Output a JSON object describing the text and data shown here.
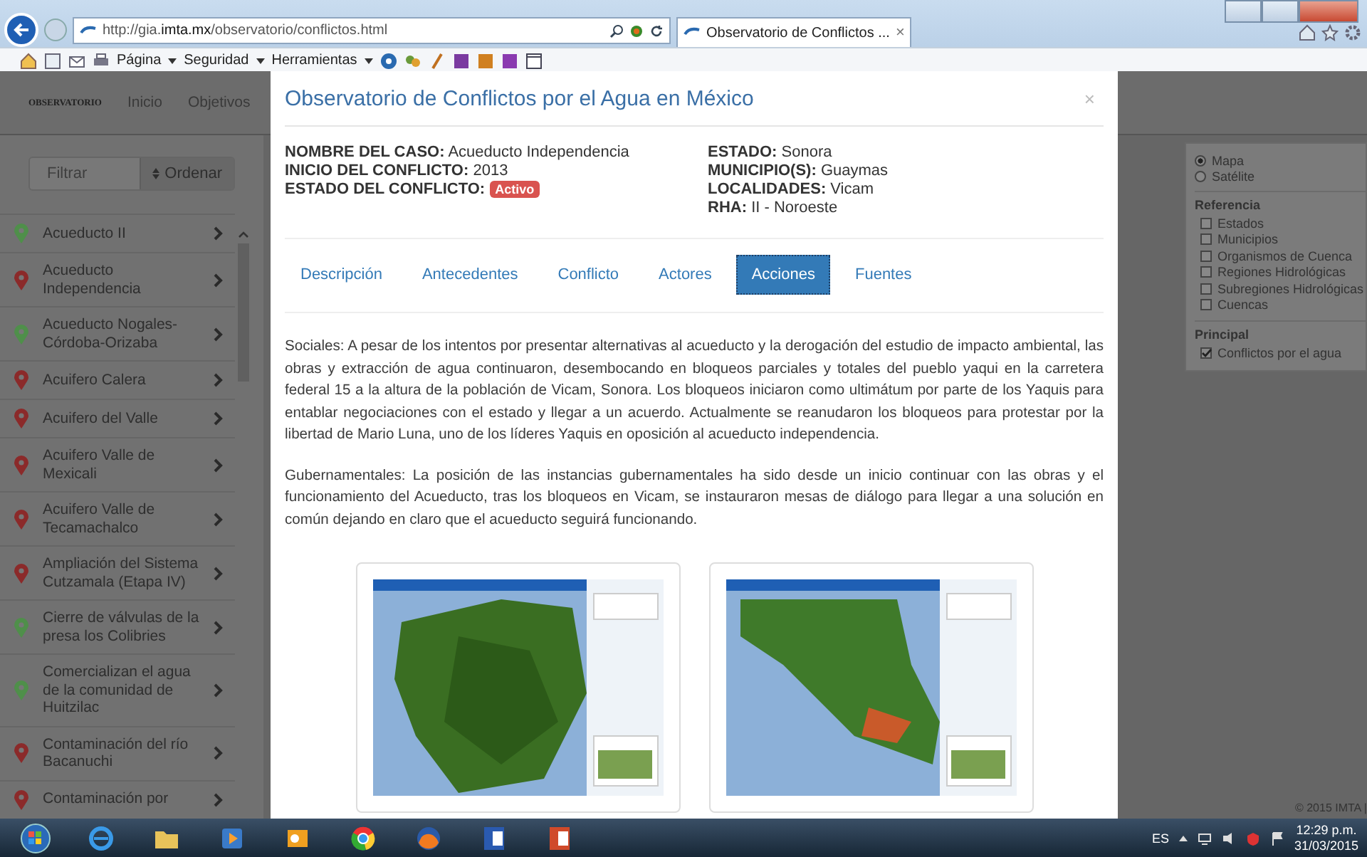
{
  "browser": {
    "address": "http://gia.**imta.mx**/observatorio/conflictos.html",
    "tab": {
      "title": "Observatorio de Conflictos ...",
      "close": "×"
    },
    "menus": [
      {
        "label": "Página"
      },
      {
        "label": "Seguridad"
      },
      {
        "label": "Herramientas"
      }
    ]
  },
  "site_nav": {
    "logo": "OBSERVATORIO",
    "links": [
      "Inicio",
      "Objetivos"
    ]
  },
  "sidebar": {
    "filter": {
      "placeholder": "Filtrar"
    },
    "sort_button": "Ordenar",
    "items": [
      {
        "label": "Acueducto II",
        "color": "#4f8f4a"
      },
      {
        "label": "Acueducto Independencia",
        "color": "#8b2a2a"
      },
      {
        "label": "Acueducto Nogales-Córdoba-Orizaba",
        "color": "#4f8f4a"
      },
      {
        "label": "Acuifero Calera",
        "color": "#8b2a2a"
      },
      {
        "label": "Acuifero del Valle",
        "color": "#8b2a2a"
      },
      {
        "label": "Acuifero Valle de Mexicali",
        "color": "#8b2a2a"
      },
      {
        "label": "Acuifero Valle de Tecamachalco",
        "color": "#8b2a2a"
      },
      {
        "label": "Ampliación del Sistema Cutzamala (Etapa IV)",
        "color": "#8b2a2a"
      },
      {
        "label": "Cierre de válvulas de la presa los Colibries",
        "color": "#4f8f4a"
      },
      {
        "label": "Comercializan el agua de la comunidad de Huitzilac",
        "color": "#4f8f4a"
      },
      {
        "label": "Contaminación del río Bacanuchi",
        "color": "#8b2a2a"
      },
      {
        "label": "Contaminación por",
        "color": "#8b2a2a"
      }
    ]
  },
  "modal": {
    "title": "Observatorio de Conflictos por el Agua en México",
    "close": "×",
    "fields_left": [
      {
        "kind": "text",
        "label": "NOMBRE DEL CASO:",
        "value": "Acueducto Independencia"
      },
      {
        "kind": "text",
        "label": "INICIO DEL CONFLICTO:",
        "value": "2013"
      },
      {
        "kind": "badge",
        "label": "ESTADO DEL CONFLICTO:",
        "value": "Activo"
      }
    ],
    "fields_right": [
      {
        "kind": "text",
        "label": "ESTADO:",
        "value": "Sonora"
      },
      {
        "kind": "text",
        "label": "MUNICIPIO(S):",
        "value": "Guaymas"
      },
      {
        "kind": "text",
        "label": "LOCALIDADES:",
        "value": "Vicam"
      },
      {
        "kind": "text",
        "label": "RHA:",
        "value": "II - Noroeste"
      }
    ],
    "tabs": [
      {
        "label": "Descripción",
        "selected": false
      },
      {
        "label": "Antecedentes",
        "selected": false
      },
      {
        "label": "Conflicto",
        "selected": false
      },
      {
        "label": "Actores",
        "selected": false
      },
      {
        "label": "Acciones",
        "selected": true
      },
      {
        "label": "Fuentes",
        "selected": false
      }
    ],
    "paragraphs": [
      "Sociales: A pesar de los intentos por presentar alternativas al acueducto y la derogación del estudio de impacto ambiental, las obras y extracción de agua continuaron, desembocando en bloqueos parciales y totales del pueblo yaqui en la carretera federal 15 a la altura de la población de Vicam, Sonora. Los bloqueos iniciaron como ultimátum por parte de los Yaquis para entablar negociaciones con el estado y llegar a un acuerdo. Actualmente se reanudaron los bloqueos para protestar por la libertad de Mario Luna, uno de los líderes Yaquis en oposición al acueducto independencia.",
      "Gubernamentales: La posición de las instancias gubernamentales ha sido desde un inicio continuar con las obras y el funcionamiento del Acueducto, tras los bloqueos en Vicam, se instauraron mesas de diálogo para llegar a una solución en común dejando en claro que el acueducto seguirá funcionando."
    ]
  },
  "layers": {
    "base": [
      {
        "label": "Mapa",
        "selected": true
      },
      {
        "label": "Satélite",
        "selected": false
      }
    ],
    "sections": [
      {
        "title": "Referencia",
        "items": [
          {
            "label": "Estados",
            "checked": false
          },
          {
            "label": "Municipios",
            "checked": false
          },
          {
            "label": "Organismos de Cuenca",
            "checked": false
          },
          {
            "label": "Regiones Hidrológicas",
            "checked": false
          },
          {
            "label": "Subregiones Hidrológicas",
            "checked": false
          },
          {
            "label": "Cuencas",
            "checked": false
          }
        ]
      },
      {
        "title": "Principal",
        "items": [
          {
            "label": "Conflictos por el agua",
            "checked": true
          }
        ]
      }
    ]
  },
  "footer": "© 2015 IMTA |",
  "taskbar": {
    "language": "ES",
    "time": "12:29 p.m.",
    "date": "31/03/2015"
  }
}
